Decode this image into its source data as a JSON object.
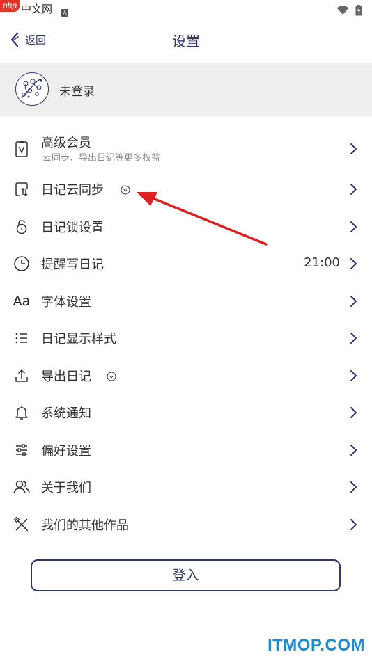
{
  "watermark_top": {
    "php": "php",
    "cn": "中文网"
  },
  "status": {
    "a_icon": "A",
    "wifi_icon": "wifi-icon",
    "battery_icon": "battery-icon"
  },
  "header": {
    "back_label": "返回",
    "title": "设置"
  },
  "profile": {
    "name": "未登录"
  },
  "menu": [
    {
      "label": "高级会员",
      "sub": "云同步、导出日记等更多权益",
      "icon": "vip-card-icon"
    },
    {
      "label": "日记云同步",
      "icon": "cloud-sync-icon",
      "badge": "vip-badge-icon"
    },
    {
      "label": "日记锁设置",
      "icon": "lock-icon"
    },
    {
      "label": "提醒写日记",
      "value": "21:00",
      "icon": "clock-icon"
    },
    {
      "label": "字体设置",
      "icon": "font-icon",
      "glyph": "Aa"
    },
    {
      "label": "日记显示样式",
      "icon": "list-icon"
    },
    {
      "label": "导出日记",
      "icon": "export-icon",
      "badge": "vip-badge-icon"
    },
    {
      "label": "系统通知",
      "icon": "bell-icon"
    },
    {
      "label": "偏好设置",
      "icon": "sliders-icon"
    },
    {
      "label": "关于我们",
      "icon": "people-icon"
    },
    {
      "label": "我们的其他作品",
      "icon": "tools-icon"
    }
  ],
  "login": {
    "label": "登入"
  },
  "watermark": "ITMOP.COM",
  "colors": {
    "accent": "#2e3570",
    "profile_bg": "#efefef",
    "annotation_arrow": "#e02020",
    "watermark": "#1e8bd1"
  }
}
